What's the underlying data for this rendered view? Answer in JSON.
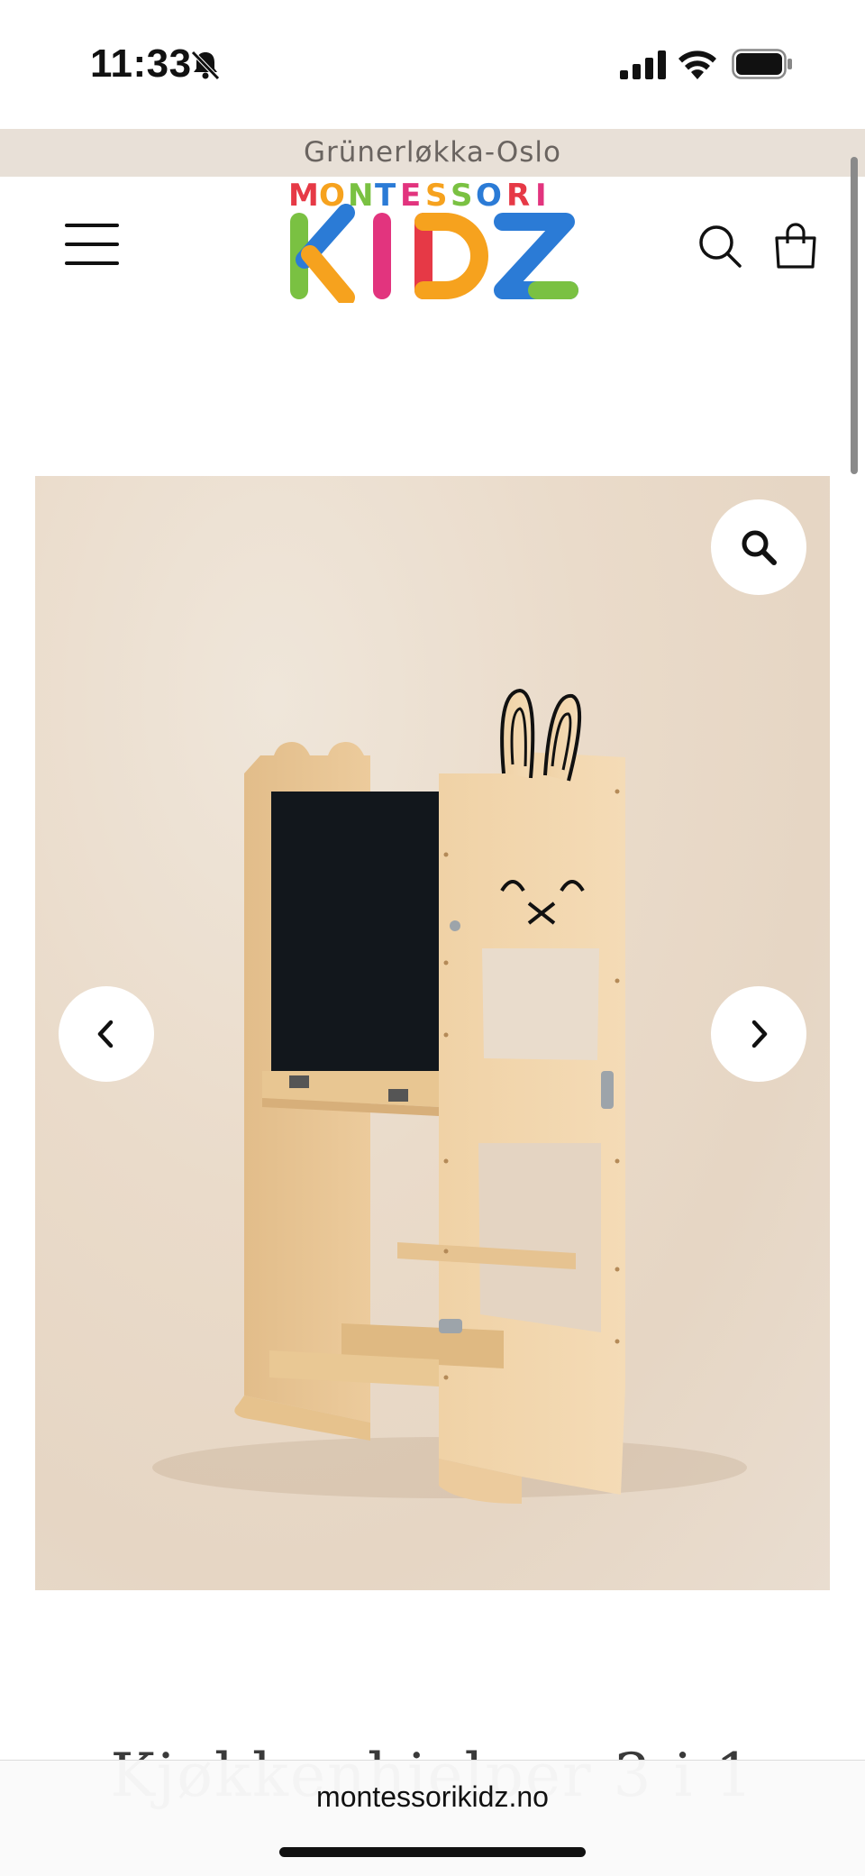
{
  "status_bar": {
    "time": "11:33",
    "icons": [
      "bell-slash-icon",
      "cellular-signal-icon",
      "wifi-icon",
      "battery-icon"
    ]
  },
  "announcement": {
    "text": "Grünerløkka-Oslo"
  },
  "header": {
    "menu_icon": "hamburger-menu-icon",
    "logo": {
      "top_text": "MONTESSORI",
      "main_text": "KIDZ",
      "colors": [
        "#e63946",
        "#f6a21e",
        "#2b7bd6",
        "#7ac142",
        "#e2347e"
      ]
    },
    "search_icon": "search-icon",
    "cart_icon": "shopping-bag-icon"
  },
  "gallery": {
    "zoom_icon": "magnifier-icon",
    "prev_icon": "chevron-left-icon",
    "next_icon": "chevron-right-icon",
    "background_color": "#e8dccd"
  },
  "product": {
    "title": "Kjøkkenhjelper 3 i 1"
  },
  "browser": {
    "url": "montessorikidz.no"
  }
}
